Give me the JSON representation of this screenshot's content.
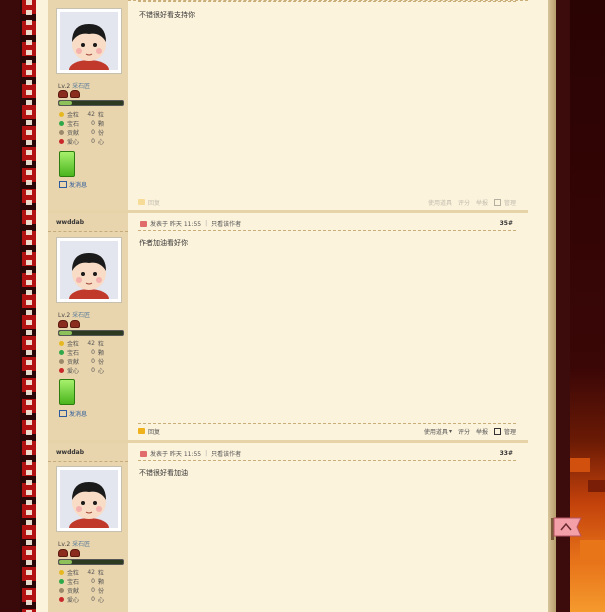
{
  "posts": [
    {
      "username": "",
      "level": "Lv.2",
      "rank": "采石匠",
      "level_progress": 0.2,
      "stats": [
        {
          "label": "金粒",
          "value": "42",
          "unit": "粒",
          "color": "#e5b821",
          "icon": "gold-icon"
        },
        {
          "label": "宝石",
          "value": "0",
          "unit": "颗",
          "color": "#2fa84a",
          "icon": "gem-icon"
        },
        {
          "label": "贡献",
          "value": "0",
          "unit": "份",
          "color": "#9c8a6c",
          "icon": "contribution-icon"
        },
        {
          "label": "爱心",
          "value": "0",
          "unit": "心",
          "color": "#c8282a",
          "icon": "heart-icon"
        }
      ],
      "send_message": "发消息",
      "post_time": "",
      "only_author": "",
      "floor": "",
      "content": "不错很好看支持你",
      "actions": {
        "reply": "回复",
        "use_item": "使用道具",
        "rate": "评分",
        "report": "举报",
        "manage": "管理"
      }
    },
    {
      "username": "wwddab",
      "level": "Lv.2",
      "rank": "采石匠",
      "level_progress": 0.2,
      "stats": [
        {
          "label": "金粒",
          "value": "42",
          "unit": "粒",
          "color": "#e5b821",
          "icon": "gold-icon"
        },
        {
          "label": "宝石",
          "value": "0",
          "unit": "颗",
          "color": "#2fa84a",
          "icon": "gem-icon"
        },
        {
          "label": "贡献",
          "value": "0",
          "unit": "份",
          "color": "#9c8a6c",
          "icon": "contribution-icon"
        },
        {
          "label": "爱心",
          "value": "0",
          "unit": "心",
          "color": "#c8282a",
          "icon": "heart-icon"
        }
      ],
      "send_message": "发消息",
      "post_time": "发表于 昨天 11:55",
      "only_author": "只看该作者",
      "floor": "35#",
      "content": "作者加油看好你",
      "actions": {
        "reply": "回复",
        "use_item": "使用道具",
        "rate": "评分",
        "report": "举报",
        "manage": "管理"
      }
    },
    {
      "username": "wwddab",
      "level": "Lv.2",
      "rank": "采石匠",
      "level_progress": 0.2,
      "stats": [
        {
          "label": "金粒",
          "value": "42",
          "unit": "粒",
          "color": "#e5b821",
          "icon": "gold-icon"
        },
        {
          "label": "宝石",
          "value": "0",
          "unit": "颗",
          "color": "#2fa84a",
          "icon": "gem-icon"
        },
        {
          "label": "贡献",
          "value": "0",
          "unit": "份",
          "color": "#9c8a6c",
          "icon": "contribution-icon"
        },
        {
          "label": "爱心",
          "value": "0",
          "unit": "心",
          "color": "#c8282a",
          "icon": "heart-icon"
        }
      ],
      "send_message": "",
      "post_time": "发表于 昨天 11:55",
      "only_author": "只看该作者",
      "floor": "33#",
      "content": "不错很好看加油",
      "actions": {
        "reply": "",
        "use_item": "",
        "rate": "",
        "report": "",
        "manage": ""
      }
    }
  ]
}
